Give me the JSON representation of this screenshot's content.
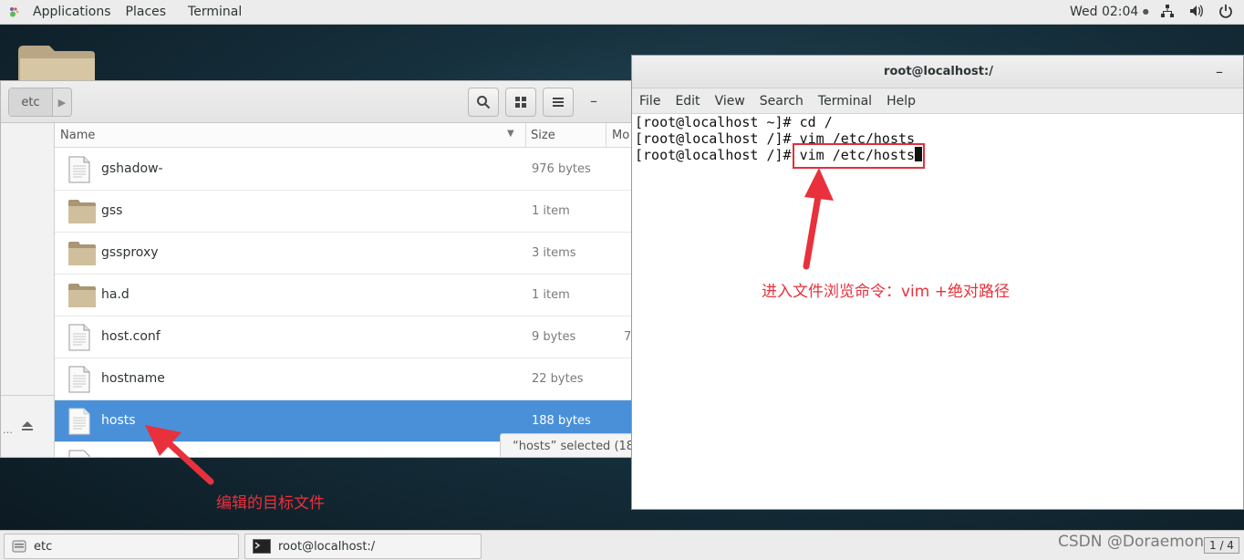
{
  "topbar": {
    "applications": "Applications",
    "places": "Places",
    "terminal": "Terminal",
    "clock": "Wed 02:04",
    "clock_indicator": "●",
    "tray_icons": [
      "network-icon",
      "volume-icon",
      "power-icon"
    ]
  },
  "file_manager": {
    "breadcrumb": "etc",
    "columns": {
      "name": "Name",
      "size": "Size",
      "modified": "Mo"
    },
    "rows": [
      {
        "name": "gshadow-",
        "size": "976 bytes",
        "type": "file"
      },
      {
        "name": "gss",
        "size": "1 item",
        "type": "folder"
      },
      {
        "name": "gssproxy",
        "size": "3 items",
        "type": "folder"
      },
      {
        "name": "ha.d",
        "size": "1 item",
        "type": "folder"
      },
      {
        "name": "host.conf",
        "size": "9 bytes",
        "type": "file",
        "extra": "7"
      },
      {
        "name": "hostname",
        "size": "22 bytes",
        "type": "file"
      },
      {
        "name": "hosts",
        "size": "188 bytes",
        "type": "file",
        "selected": true
      }
    ],
    "status": "“hosts” selected  (18",
    "sidebar_dots": "…"
  },
  "terminal": {
    "title": "root@localhost:/",
    "menu": [
      "File",
      "Edit",
      "View",
      "Search",
      "Terminal",
      "Help"
    ],
    "lines": [
      "[root@localhost ~]# cd /",
      "[root@localhost /]# vim /etc/hosts",
      "[root@localhost /]# vim /etc/hosts"
    ]
  },
  "annotations": {
    "command_note": "进入文件浏览命令：vim +绝对路径",
    "target_note": "编辑的目标文件",
    "color": "#e8313c"
  },
  "taskbar": {
    "etc": "etc",
    "terminal": "root@localhost:/",
    "watermark": "CSDN @Doraemon_",
    "pager": "1 / 4"
  },
  "colors": {
    "selection": "#4a90d9",
    "highlight_box": "#e0303a",
    "folder": "#c9b896"
  }
}
